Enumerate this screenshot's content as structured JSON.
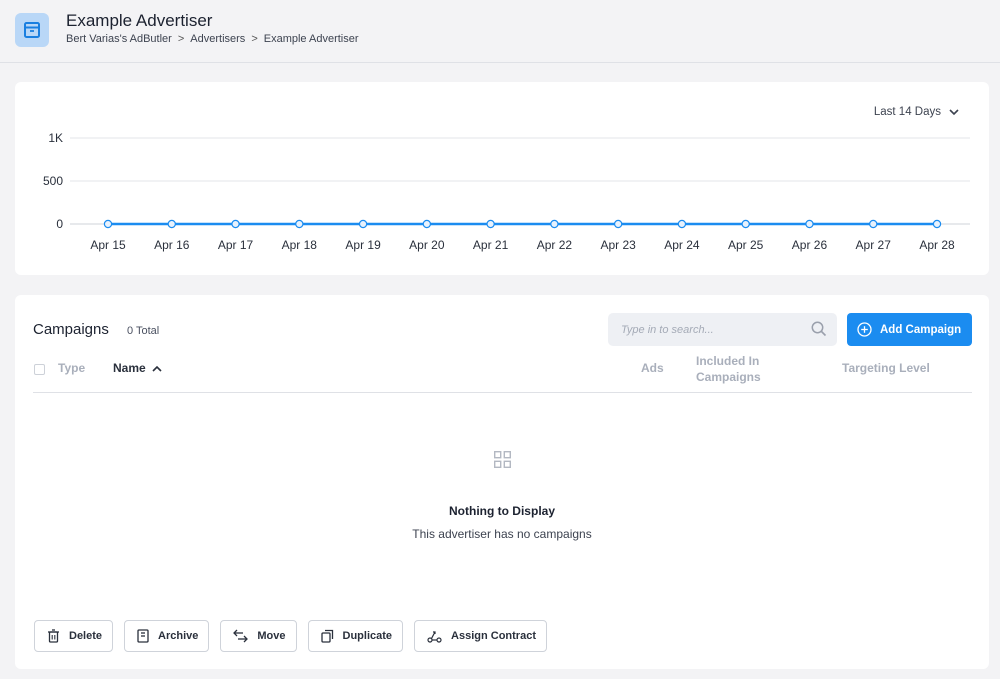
{
  "header": {
    "title": "Example Advertiser",
    "breadcrumb": [
      "Bert Varias's AdButler",
      "Advertisers",
      "Example Advertiser"
    ],
    "breadcrumb_sep": ">",
    "icon": "archive-box-icon"
  },
  "chart": {
    "range_label": "Last 14 Days",
    "line_color": "#1b8cf0"
  },
  "chart_data": {
    "type": "line",
    "categories": [
      "Apr 15",
      "Apr 16",
      "Apr 17",
      "Apr 18",
      "Apr 19",
      "Apr 20",
      "Apr 21",
      "Apr 22",
      "Apr 23",
      "Apr 24",
      "Apr 25",
      "Apr 26",
      "Apr 27",
      "Apr 28"
    ],
    "series": [
      {
        "values": [
          0,
          0,
          0,
          0,
          0,
          0,
          0,
          0,
          0,
          0,
          0,
          0,
          0,
          0
        ]
      }
    ],
    "yticks": [
      "0",
      "500",
      "1K"
    ],
    "ytick_values": [
      0,
      500,
      1000
    ],
    "ylim": [
      0,
      1000
    ],
    "grid": true
  },
  "campaigns": {
    "title": "Campaigns",
    "total": "0 Total",
    "search_placeholder": "Type in to search...",
    "add_label": "Add Campaign",
    "columns": {
      "type": "Type",
      "name": "Name",
      "ads": "Ads",
      "included_line1": "Included In",
      "included_line2": "Campaigns",
      "targeting": "Targeting Level"
    },
    "empty_title": "Nothing to Display",
    "empty_sub": "This advertiser has no campaigns",
    "actions": {
      "delete": "Delete",
      "archive": "Archive",
      "move": "Move",
      "duplicate": "Duplicate",
      "assign": "Assign Contract"
    }
  },
  "colors": {
    "accent": "#1b8cf0",
    "icon_bg": "#b9d7f7"
  }
}
